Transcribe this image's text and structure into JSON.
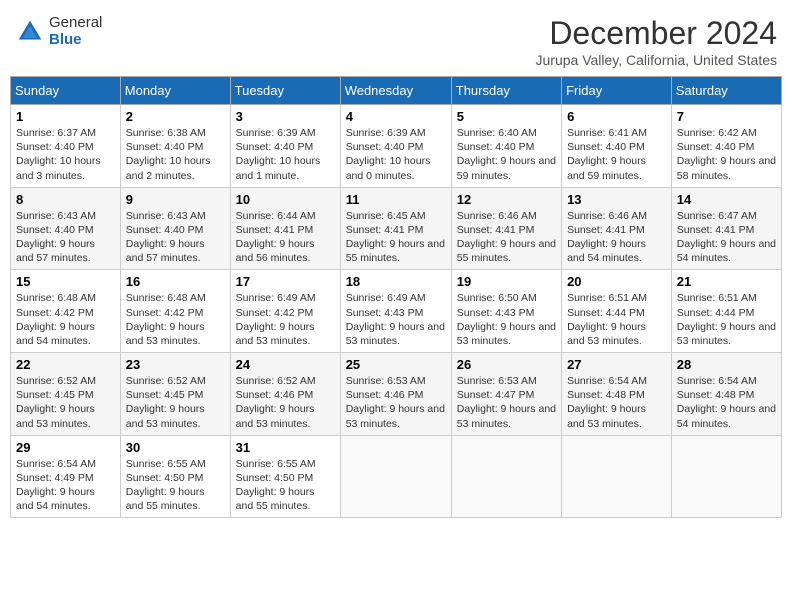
{
  "header": {
    "logo_general": "General",
    "logo_blue": "Blue",
    "title": "December 2024",
    "location": "Jurupa Valley, California, United States"
  },
  "columns": [
    "Sunday",
    "Monday",
    "Tuesday",
    "Wednesday",
    "Thursday",
    "Friday",
    "Saturday"
  ],
  "weeks": [
    [
      {
        "day": "1",
        "sunrise": "6:37 AM",
        "sunset": "4:40 PM",
        "daylight": "10 hours and 3 minutes."
      },
      {
        "day": "2",
        "sunrise": "6:38 AM",
        "sunset": "4:40 PM",
        "daylight": "10 hours and 2 minutes."
      },
      {
        "day": "3",
        "sunrise": "6:39 AM",
        "sunset": "4:40 PM",
        "daylight": "10 hours and 1 minute."
      },
      {
        "day": "4",
        "sunrise": "6:39 AM",
        "sunset": "4:40 PM",
        "daylight": "10 hours and 0 minutes."
      },
      {
        "day": "5",
        "sunrise": "6:40 AM",
        "sunset": "4:40 PM",
        "daylight": "9 hours and 59 minutes."
      },
      {
        "day": "6",
        "sunrise": "6:41 AM",
        "sunset": "4:40 PM",
        "daylight": "9 hours and 59 minutes."
      },
      {
        "day": "7",
        "sunrise": "6:42 AM",
        "sunset": "4:40 PM",
        "daylight": "9 hours and 58 minutes."
      }
    ],
    [
      {
        "day": "8",
        "sunrise": "6:43 AM",
        "sunset": "4:40 PM",
        "daylight": "9 hours and 57 minutes."
      },
      {
        "day": "9",
        "sunrise": "6:43 AM",
        "sunset": "4:40 PM",
        "daylight": "9 hours and 57 minutes."
      },
      {
        "day": "10",
        "sunrise": "6:44 AM",
        "sunset": "4:41 PM",
        "daylight": "9 hours and 56 minutes."
      },
      {
        "day": "11",
        "sunrise": "6:45 AM",
        "sunset": "4:41 PM",
        "daylight": "9 hours and 55 minutes."
      },
      {
        "day": "12",
        "sunrise": "6:46 AM",
        "sunset": "4:41 PM",
        "daylight": "9 hours and 55 minutes."
      },
      {
        "day": "13",
        "sunrise": "6:46 AM",
        "sunset": "4:41 PM",
        "daylight": "9 hours and 54 minutes."
      },
      {
        "day": "14",
        "sunrise": "6:47 AM",
        "sunset": "4:41 PM",
        "daylight": "9 hours and 54 minutes."
      }
    ],
    [
      {
        "day": "15",
        "sunrise": "6:48 AM",
        "sunset": "4:42 PM",
        "daylight": "9 hours and 54 minutes."
      },
      {
        "day": "16",
        "sunrise": "6:48 AM",
        "sunset": "4:42 PM",
        "daylight": "9 hours and 53 minutes."
      },
      {
        "day": "17",
        "sunrise": "6:49 AM",
        "sunset": "4:42 PM",
        "daylight": "9 hours and 53 minutes."
      },
      {
        "day": "18",
        "sunrise": "6:49 AM",
        "sunset": "4:43 PM",
        "daylight": "9 hours and 53 minutes."
      },
      {
        "day": "19",
        "sunrise": "6:50 AM",
        "sunset": "4:43 PM",
        "daylight": "9 hours and 53 minutes."
      },
      {
        "day": "20",
        "sunrise": "6:51 AM",
        "sunset": "4:44 PM",
        "daylight": "9 hours and 53 minutes."
      },
      {
        "day": "21",
        "sunrise": "6:51 AM",
        "sunset": "4:44 PM",
        "daylight": "9 hours and 53 minutes."
      }
    ],
    [
      {
        "day": "22",
        "sunrise": "6:52 AM",
        "sunset": "4:45 PM",
        "daylight": "9 hours and 53 minutes."
      },
      {
        "day": "23",
        "sunrise": "6:52 AM",
        "sunset": "4:45 PM",
        "daylight": "9 hours and 53 minutes."
      },
      {
        "day": "24",
        "sunrise": "6:52 AM",
        "sunset": "4:46 PM",
        "daylight": "9 hours and 53 minutes."
      },
      {
        "day": "25",
        "sunrise": "6:53 AM",
        "sunset": "4:46 PM",
        "daylight": "9 hours and 53 minutes."
      },
      {
        "day": "26",
        "sunrise": "6:53 AM",
        "sunset": "4:47 PM",
        "daylight": "9 hours and 53 minutes."
      },
      {
        "day": "27",
        "sunrise": "6:54 AM",
        "sunset": "4:48 PM",
        "daylight": "9 hours and 53 minutes."
      },
      {
        "day": "28",
        "sunrise": "6:54 AM",
        "sunset": "4:48 PM",
        "daylight": "9 hours and 54 minutes."
      }
    ],
    [
      {
        "day": "29",
        "sunrise": "6:54 AM",
        "sunset": "4:49 PM",
        "daylight": "9 hours and 54 minutes."
      },
      {
        "day": "30",
        "sunrise": "6:55 AM",
        "sunset": "4:50 PM",
        "daylight": "9 hours and 55 minutes."
      },
      {
        "day": "31",
        "sunrise": "6:55 AM",
        "sunset": "4:50 PM",
        "daylight": "9 hours and 55 minutes."
      },
      null,
      null,
      null,
      null
    ]
  ]
}
